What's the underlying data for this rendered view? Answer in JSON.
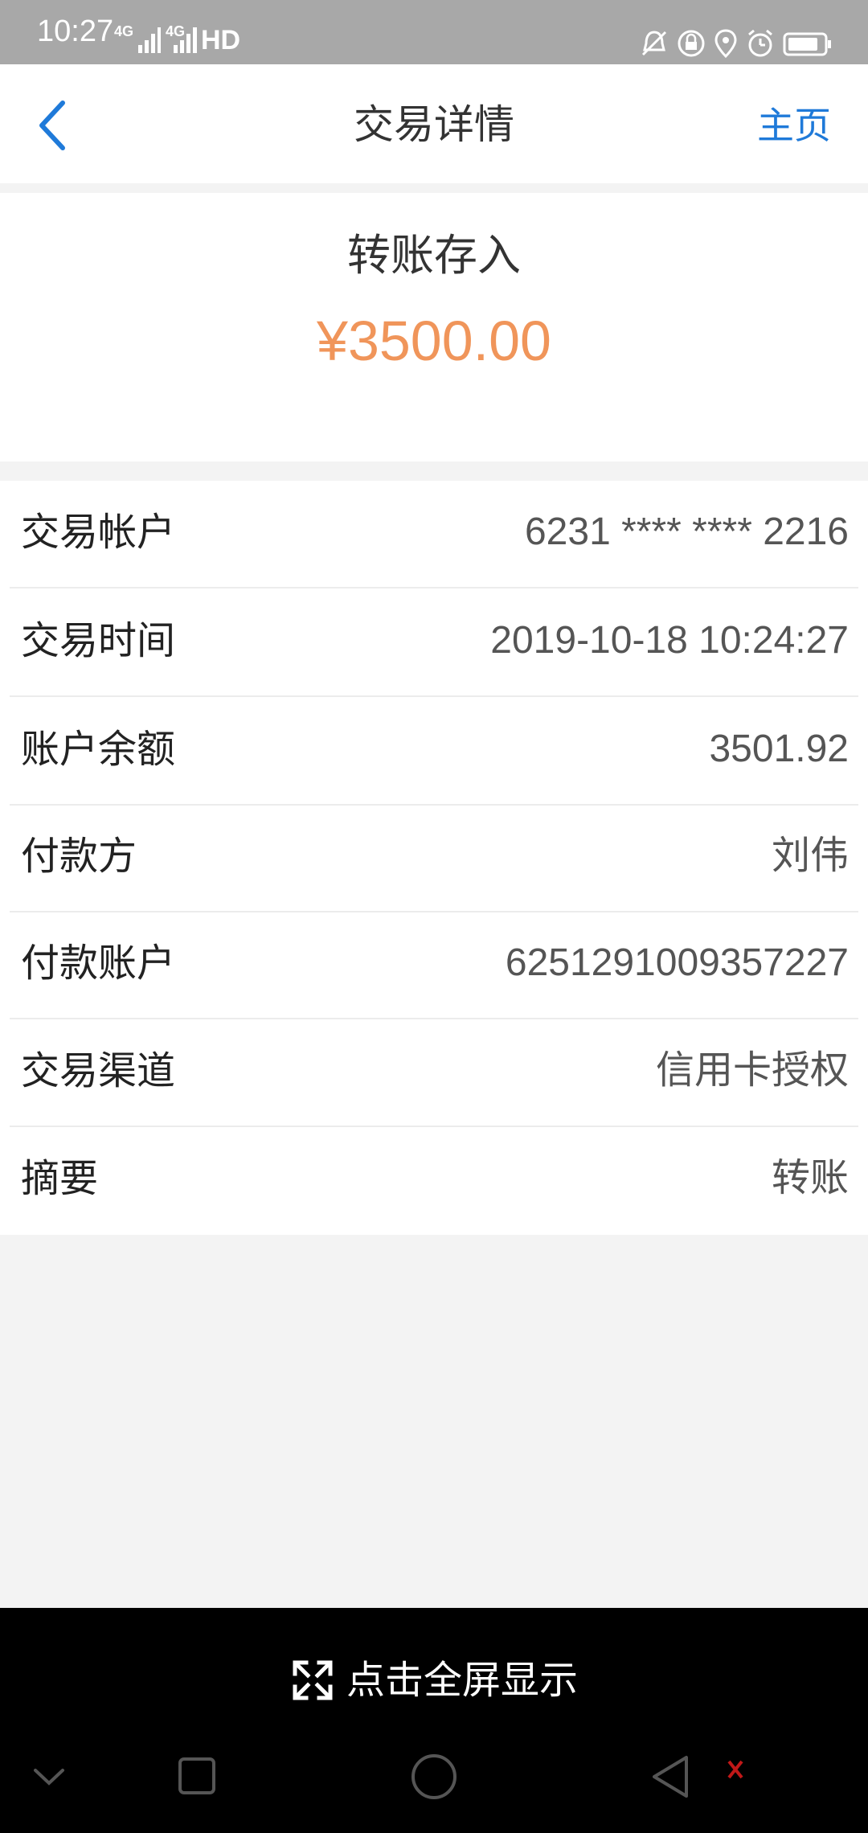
{
  "status_bar": {
    "time": "10:27",
    "sig1": "4G",
    "sig2": "4G",
    "hd": "HD"
  },
  "nav": {
    "title": "交易详情",
    "home_label": "主页"
  },
  "summary": {
    "type": "转账存入",
    "amount": "¥3500.00",
    "amount_color": "#f0955a"
  },
  "details": [
    {
      "label": "交易帐户",
      "value": "6231 **** **** 2216"
    },
    {
      "label": "交易时间",
      "value": "2019-10-18 10:24:27"
    },
    {
      "label": "账户余额",
      "value": "3501.92"
    },
    {
      "label": "付款方",
      "value": "刘伟"
    },
    {
      "label": "付款账户",
      "value": "6251291009357227"
    },
    {
      "label": "交易渠道",
      "value": "信用卡授权"
    },
    {
      "label": "摘要",
      "value": "转账"
    }
  ],
  "fullscreen": {
    "label": "点击全屏显示"
  },
  "colors": {
    "accent": "#1f7ad9",
    "status_bar": "#a8a8a8"
  }
}
